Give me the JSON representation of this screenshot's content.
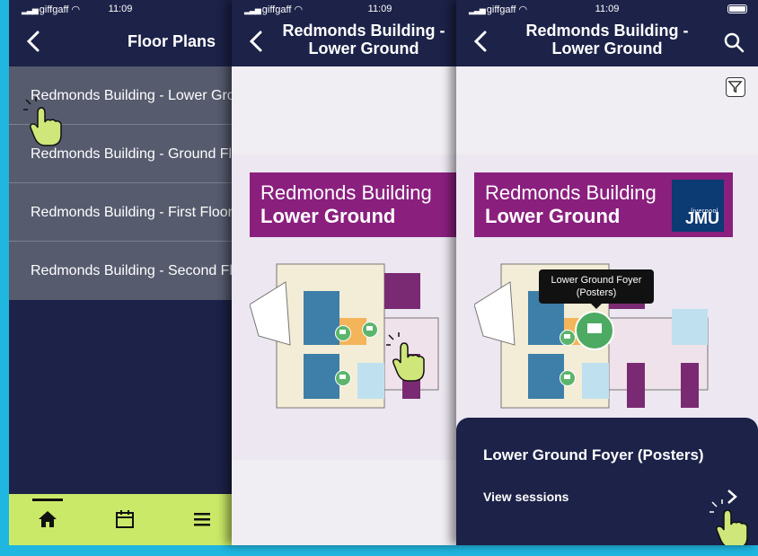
{
  "status": {
    "carrier": "giffgaff",
    "time": "11:09"
  },
  "screen1": {
    "title": "Floor Plans",
    "items": [
      {
        "label": "Redmonds Building - Lower Ground"
      },
      {
        "label": "Redmonds Building - Ground Floor"
      },
      {
        "label": "Redmonds Building - First Floor"
      },
      {
        "label": "Redmonds Building - Second Floor"
      }
    ],
    "tabs": [
      {
        "icon": "home-icon",
        "active": true
      },
      {
        "icon": "calendar-icon",
        "active": false
      },
      {
        "icon": "menu-icon",
        "active": false
      }
    ]
  },
  "screen2": {
    "title": "Redmonds Building - Lower Ground",
    "banner_line1": "Redmonds Building",
    "banner_line2": "Lower Ground"
  },
  "screen3": {
    "title": "Redmonds Building - Lower Ground",
    "banner_line1": "Redmonds Building",
    "banner_line2": "Lower Ground",
    "logo_small": "liverpool",
    "logo_big": "JMU",
    "tooltip": "Lower Ground Foyer (Posters)",
    "sheet_title": "Lower Ground Foyer (Posters)",
    "sheet_action": "View sessions"
  },
  "colors": {
    "background": "#1fb6e0",
    "navbar": "#1c2248",
    "list": "#565b6e",
    "tabbar": "#cbe968",
    "banner": "#8a1f7e",
    "marker": "#5cb56c"
  }
}
